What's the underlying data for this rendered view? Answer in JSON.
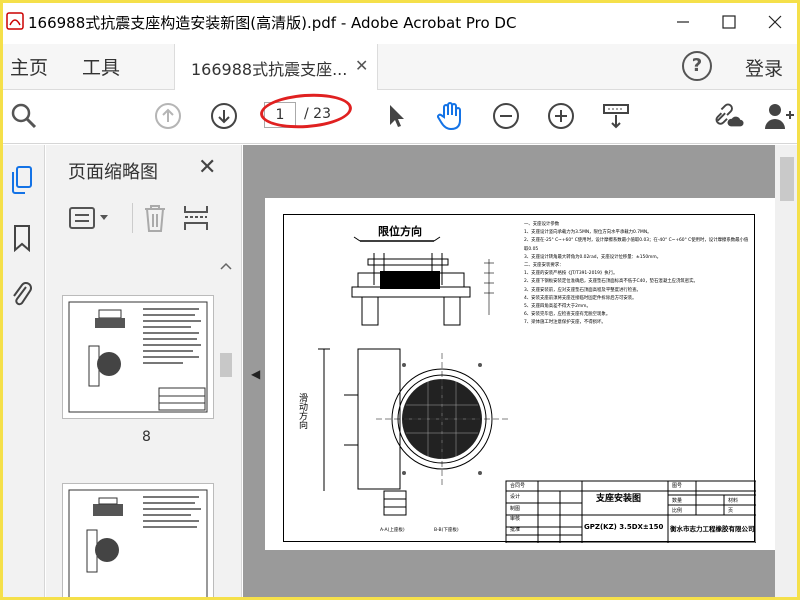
{
  "window": {
    "title": "166988式抗震支座构造安装新图(高清版).pdf - Adobe Acrobat Pro DC"
  },
  "menu": {
    "home": "主页",
    "tools": "工具",
    "doc_tab": "166988式抗震支座...",
    "help": "?",
    "login": "登录"
  },
  "toolbar": {
    "current_page": "1",
    "total_pages": "/ 23"
  },
  "panel": {
    "title": "页面缩略图",
    "thumbs": [
      {
        "label": "8"
      },
      {
        "label": ""
      }
    ]
  },
  "drawing": {
    "heading_direction": "限位方向",
    "side_direction": "滑动方向",
    "notes": [
      "一、支座设计参数",
      "1、支座设计竖向承载力为3.5MN，限位方向水平承载力0.7MN。",
      "2、支座在-25° C~+60° C使用时，设计摩擦系数最小值取0.03；在-40° C~+60° C使用时，设计摩擦系数最小值取0.05",
      "3、支座设计转角最大转角为0.02rad，支座设计位移量：±150mm。",
      "二、支座安装要求：",
      "1、支座的安装严格按《JT/T391-2019》执行。",
      "2、支座下钢板安装定位准确后，支座垫石顶面标高不低于C40，垫石混凝土应浇筑密实。",
      "3、支座安装前，应对支座垫石顶面高程及平整度进行检查。",
      "4、安装支座前须将支座连接临时固定件拆除后方可安装。",
      "5、支座四角高差不得大于2mm。",
      "6、安装完毕后，应检查支座有无脱空现象。",
      "7、梁体施工时注意保护支座，不得损坏。"
    ],
    "title_block": {
      "drawing_title": "支座安装图",
      "model": "GPZ(KZ) 3.5DX±150",
      "company": "衡水市志力工程橡胶有限公司",
      "rows": [
        "合同号",
        "设计",
        "制图",
        "审核",
        "批准"
      ],
      "right_rows": [
        "图号",
        "数量",
        "材料",
        "比例",
        "页"
      ],
      "right_values": [
        "",
        "",
        "",
        "",
        "页"
      ]
    },
    "bottom_labels": [
      "A-A(上座板)",
      "B-B(下座板)"
    ]
  },
  "colors": {
    "accent_blue": "#1473e6",
    "red_oval": "#e02020",
    "frame_yellow": "#f5e04a"
  }
}
